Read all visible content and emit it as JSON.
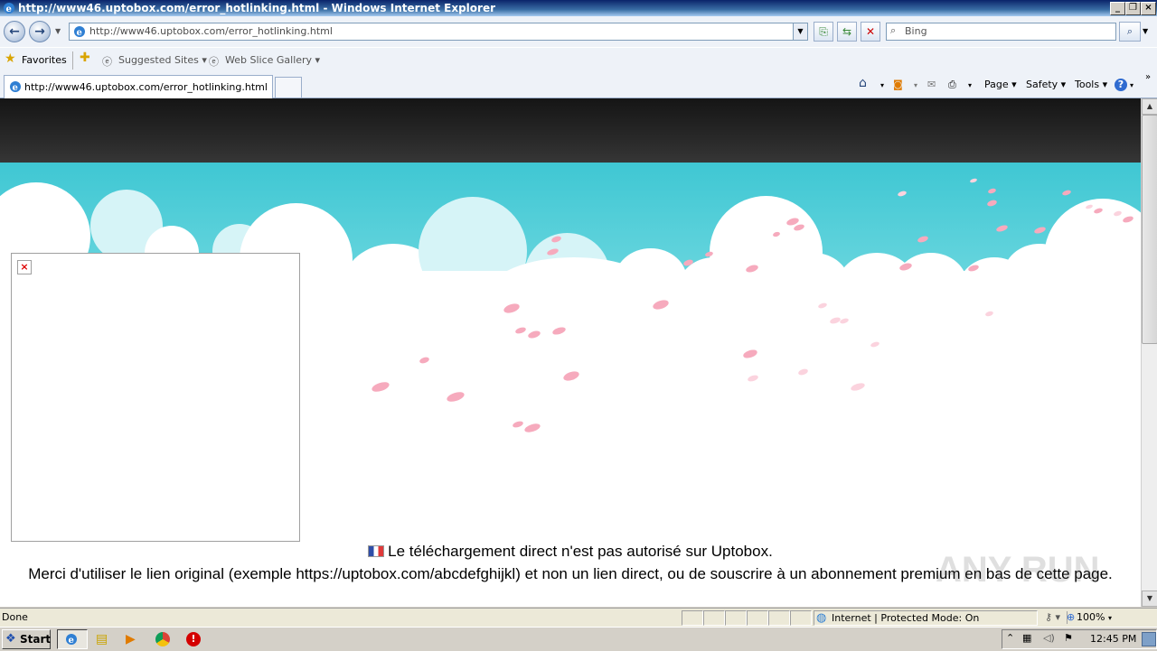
{
  "window": {
    "title": "http://www46.uptobox.com/error_hotlinking.html - Windows Internet Explorer"
  },
  "navbar": {
    "address": "http://www46.uptobox.com/error_hotlinking.html",
    "search_placeholder": "Bing"
  },
  "favbar": {
    "favorites": "Favorites",
    "suggested": "Suggested Sites",
    "webslice": "Web Slice Gallery"
  },
  "tabs": [
    {
      "label": "http://www46.uptobox.com/error_hotlinking.html"
    }
  ],
  "commandbar": {
    "page": "Page",
    "safety": "Safety",
    "tools": "Tools"
  },
  "content": {
    "line1": "Le téléchargement direct n'est pas autorisé sur Uptobox.",
    "line2": "Merci d'utiliser le lien original (exemple https://uptobox.com/abcdefghijkl) et non un lien direct, ou de souscrire à un abonnement premium en bas de cette page."
  },
  "statusbar": {
    "status": "Done",
    "zone": "Internet | Protected Mode: On",
    "zoom": "100%"
  },
  "taskbar": {
    "start": "Start",
    "clock": "12:45 PM"
  },
  "watermark": "ANY RUN",
  "colors": {
    "sky": "#3fc7d3",
    "petal": "#f6aabd",
    "titlebar": "#0a246a"
  }
}
